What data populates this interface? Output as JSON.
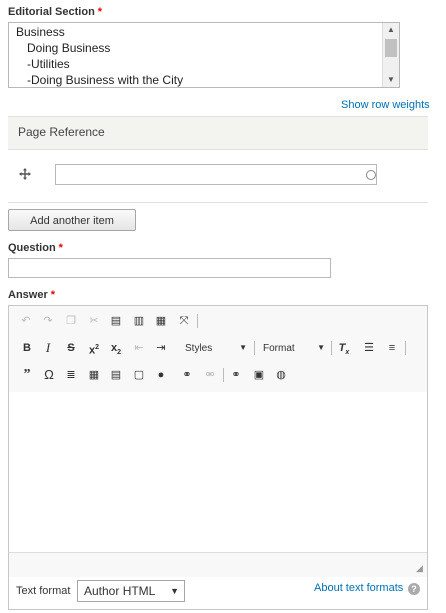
{
  "editorial_section": {
    "label": "Editorial Section",
    "required_mark": "*",
    "options": [
      "Business",
      "Doing Business",
      "-Utilities",
      "-Doing Business with the City"
    ]
  },
  "show_row_weights": "Show row weights",
  "page_reference": {
    "header": "Page Reference",
    "add_button": "Add another item"
  },
  "question": {
    "label": "Question",
    "required_mark": "*",
    "value": ""
  },
  "answer": {
    "label": "Answer",
    "required_mark": "*",
    "toolbar": {
      "styles_label": "Styles",
      "format_label": "Format"
    },
    "text_format_label": "Text format",
    "text_format_value": "Author HTML",
    "about_link": "About text formats",
    "help_glyph": "?"
  },
  "colors": {
    "required": "#ee0000",
    "link": "#0071b3"
  }
}
